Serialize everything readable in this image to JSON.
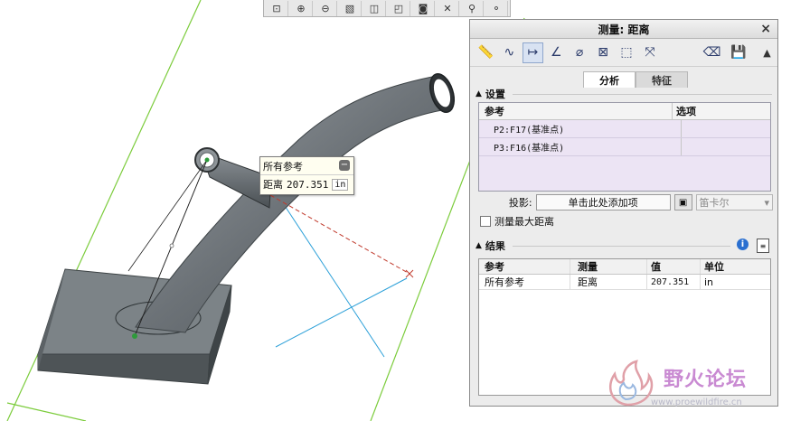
{
  "toolbar": {
    "items": [
      {
        "name": "zoom-fit-icon",
        "glyph": "⊡"
      },
      {
        "name": "zoom-in-icon",
        "glyph": "⊕"
      },
      {
        "name": "zoom-out-icon",
        "glyph": "⊖"
      },
      {
        "name": "repaint-icon",
        "glyph": "▧"
      },
      {
        "name": "display-style-icon",
        "glyph": "◫"
      },
      {
        "name": "view-orient-icon",
        "glyph": "◰"
      },
      {
        "name": "saved-views-icon",
        "glyph": "◙"
      },
      {
        "name": "datum-display-icon",
        "glyph": "✕"
      },
      {
        "name": "annotation-display-icon",
        "glyph": "⚲"
      },
      {
        "name": "spin-center-icon",
        "glyph": "⚬"
      }
    ]
  },
  "callout": {
    "title": "所有参考",
    "measure_label": "距离",
    "value": "207.351",
    "unit": "in",
    "collapse_glyph": "−"
  },
  "dialog": {
    "title": "测量: 距离",
    "close_glyph": "×",
    "tools": [
      {
        "name": "length-tool-icon",
        "glyph": "📏"
      },
      {
        "name": "curve-length-tool-icon",
        "glyph": "∿"
      },
      {
        "name": "distance-tool-icon",
        "glyph": "↦"
      },
      {
        "name": "angle-tool-icon",
        "glyph": "∠"
      },
      {
        "name": "diameter-tool-icon",
        "glyph": "⌀"
      },
      {
        "name": "area-tool-icon",
        "glyph": "⊠"
      },
      {
        "name": "volume-tool-icon",
        "glyph": "⬚"
      },
      {
        "name": "transform-tool-icon",
        "glyph": "⤧"
      }
    ],
    "eraser_glyph": "⌫",
    "save_glyph": "💾",
    "collapse_glyph": "▲",
    "tabs": {
      "analysis": "分析",
      "feature": "特征"
    },
    "settings": {
      "heading": "设置",
      "col_reference": "参考",
      "col_options": "选项",
      "references": [
        "P2:F17(基准点)",
        "P3:F16(基准点)"
      ],
      "projection_label": "投影:",
      "projection_placeholder": "单击此处添加项",
      "coordinate_select": "笛卡尔",
      "max_distance_label": "测量最大距离"
    },
    "results": {
      "heading": "结果",
      "info_glyph": "i",
      "columns": [
        "参考",
        "测量",
        "值",
        "单位"
      ],
      "rows": [
        {
          "reference": "所有参考",
          "measure": "距离",
          "value": "207.351",
          "unit": "in"
        }
      ]
    }
  },
  "watermark": {
    "text": "野火论坛",
    "url": "www.proewildfire.cn"
  },
  "colors": {
    "model_gray": "#6f7478",
    "dimension_line": "#c0392b",
    "axis_blue": "#2a9fd8",
    "frame_green": "#7ccc3c",
    "tab_active": "#ffffff",
    "ref_table_bg": "#ece4f4"
  }
}
